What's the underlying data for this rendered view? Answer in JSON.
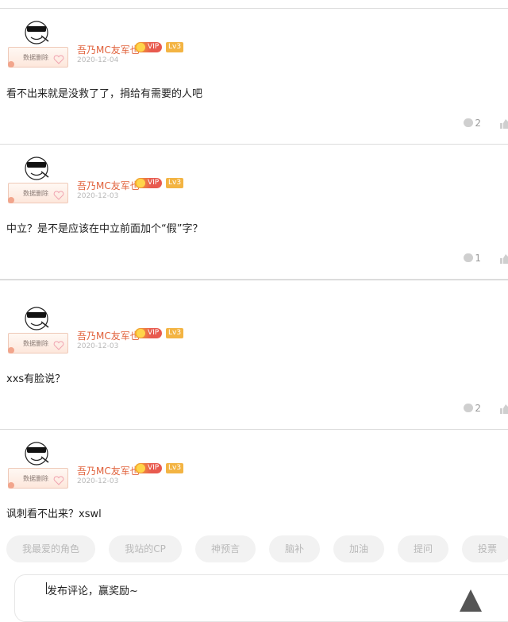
{
  "feed": {
    "posts": [
      {
        "username": "吾乃MC友军也",
        "vip": "VIP",
        "level": "Lv3",
        "frame_text": "数据删除",
        "date": "2020-12-04",
        "content": "看不出来就是没救了了，捐给有需要的人吧",
        "replies": "2"
      },
      {
        "username": "吾乃MC友军也",
        "vip": "VIP",
        "level": "Lv3",
        "frame_text": "数据删除",
        "date": "2020-12-03",
        "content": "中立？是不是应该在中立前面加个“假”字？",
        "replies": "1"
      },
      {
        "username": "吾乃MC友军也",
        "vip": "VIP",
        "level": "Lv3",
        "frame_text": "数据删除",
        "date": "2020-12-03",
        "content": "xxs有脸说？",
        "replies": "2"
      },
      {
        "username": "吾乃MC友军也",
        "vip": "VIP",
        "level": "Lv3",
        "frame_text": "数据删除",
        "date": "2020-12-03",
        "content": "讽刺看不出来？xswl",
        "replies": ""
      }
    ]
  },
  "quick_tags": [
    "我最爱的角色",
    "我站的CP",
    "神预言",
    "脑补",
    "加油",
    "提问",
    "投票"
  ],
  "composer": {
    "placeholder": "发布评论，赢奖励~",
    "send_icon": "triangle-up-icon"
  },
  "colors": {
    "username": "#e0603a",
    "date": "#b8b8b8",
    "tag_bg": "#f2f2f2",
    "tag_text": "#b9b9b9",
    "level_badge": "#f3b443"
  }
}
